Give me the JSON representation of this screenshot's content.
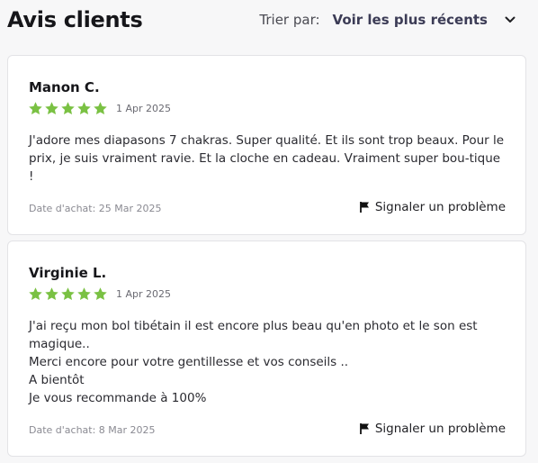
{
  "header": {
    "title": "Avis clients",
    "sort_label": "Trier par:",
    "sort_value": "Voir les plus récents"
  },
  "colors": {
    "star": "#7ac143",
    "accent_text": "#3c3c56"
  },
  "icons": {
    "sort_chevron": "chevron-down-icon",
    "rating_star": "star-icon",
    "report_flag": "flag-icon"
  },
  "reviews": [
    {
      "name": "Manon C.",
      "rating": 5,
      "date": "1 Apr 2025",
      "text": "J'adore mes diapasons 7 chakras. Super qualité. Et ils sont trop beaux. Pour le prix, je suis vraiment ravie. Et la cloche en cadeau. Vraiment super bou-tique !",
      "purchase_date": "Date d'achat: 25 Mar 2025",
      "report_label": "Signaler un problème"
    },
    {
      "name": "Virginie L.",
      "rating": 5,
      "date": "1 Apr 2025",
      "text": "J'ai reçu mon bol tibétain il est encore plus beau qu'en photo et le son est magique..\nMerci encore pour votre gentillesse et vos conseils ..\nA bientôt\nJe vous recommande à 100%",
      "purchase_date": "Date d'achat: 8 Mar 2025",
      "report_label": "Signaler un problème"
    }
  ]
}
